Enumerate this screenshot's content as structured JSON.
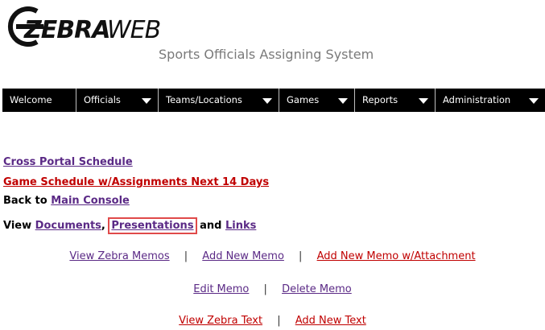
{
  "logo": {
    "brand_bold": "ZEBRA",
    "brand_light": "WEB"
  },
  "header": {
    "subtitle": "Sports Officials Assigning System"
  },
  "nav": [
    {
      "label": "Welcome",
      "has_menu": false
    },
    {
      "label": "Officials",
      "has_menu": true
    },
    {
      "label": "Teams/Locations",
      "has_menu": true
    },
    {
      "label": "Games",
      "has_menu": true
    },
    {
      "label": "Reports",
      "has_menu": true
    },
    {
      "label": "Administration",
      "has_menu": true
    }
  ],
  "links": {
    "cross_portal": "Cross Portal Schedule",
    "game_schedule": "Game Schedule w/Assignments Next 14 Days",
    "back_to": "Back to",
    "main_console": "Main Console",
    "view": "View",
    "documents": "Documents",
    "comma": ",",
    "presentations": "Presentations",
    "and": "and",
    "links": "Links"
  },
  "memos": {
    "view_zebra_memos": "View Zebra Memos",
    "add_new_memo": "Add New Memo",
    "add_new_memo_attachment": "Add New Memo w/Attachment",
    "edit_memo": "Edit Memo",
    "delete_memo": "Delete Memo",
    "view_zebra_text": "View Zebra Text",
    "add_new_text": "Add New Text",
    "separator": "|"
  },
  "colors": {
    "purple_link": "#5b2a86",
    "red_link": "#c00000",
    "nav_bg": "#000000",
    "highlight": "#e04a4a"
  }
}
